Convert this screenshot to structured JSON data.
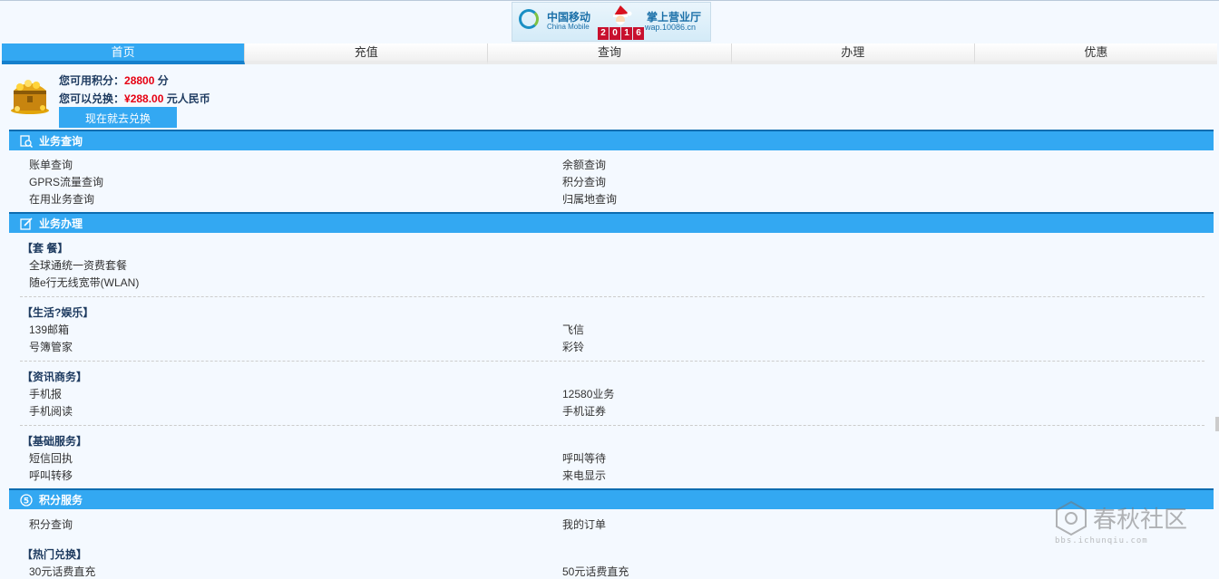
{
  "header": {
    "logo_cn": "中国移动",
    "logo_en": "China Mobile",
    "year_digits": [
      "2",
      "0",
      "1",
      "6"
    ],
    "logo_title": "掌上营业厅",
    "logo_url": "wap.10086.cn"
  },
  "nav": {
    "tabs": [
      {
        "label": "首页",
        "active": true
      },
      {
        "label": "充值",
        "active": false
      },
      {
        "label": "查询",
        "active": false
      },
      {
        "label": "办理",
        "active": false
      },
      {
        "label": "优惠",
        "active": false
      }
    ]
  },
  "points": {
    "available_label": "您可用积分：",
    "available_value": "28800",
    "available_unit": " 分",
    "exchange_label": "您可以兑换：",
    "exchange_value": "¥288.00",
    "exchange_unit": " 元人民币",
    "redeem_button": "现在就去兑换"
  },
  "query": {
    "title": "业务查询",
    "items": [
      "账单查询",
      "余额查询",
      "GPRS流量查询",
      "积分查询",
      "在用业务查询",
      "归属地查询"
    ]
  },
  "business": {
    "title": "业务办理",
    "groups": [
      {
        "name": "【套 餐】",
        "items": [
          "全球通统一资费套餐",
          "随e行无线宽带(WLAN)"
        ]
      },
      {
        "name": "【生活?娱乐】",
        "items": [
          "139邮箱",
          "飞信",
          "号簿管家",
          "彩铃"
        ]
      },
      {
        "name": "【资讯商务】",
        "items": [
          "手机报",
          "12580业务",
          "手机阅读",
          "手机证券"
        ]
      },
      {
        "name": "【基础服务】",
        "items": [
          "短信回执",
          "呼叫等待",
          "呼叫转移",
          "来电显示"
        ]
      }
    ]
  },
  "points_service": {
    "title": "积分服务",
    "items": [
      "积分查询",
      "我的订单"
    ],
    "hot_title": "【热门兑换】",
    "hot_items": [
      "30元话费直充",
      "50元话费直充"
    ]
  },
  "watermark": {
    "brand": "春秋社区",
    "url": "bbs.ichunqiu.com"
  },
  "colors": {
    "accent": "#33a8f2",
    "accent_border": "#0d6cb0",
    "highlight_red": "#e60012",
    "page_bg": "#f4f9ff"
  }
}
